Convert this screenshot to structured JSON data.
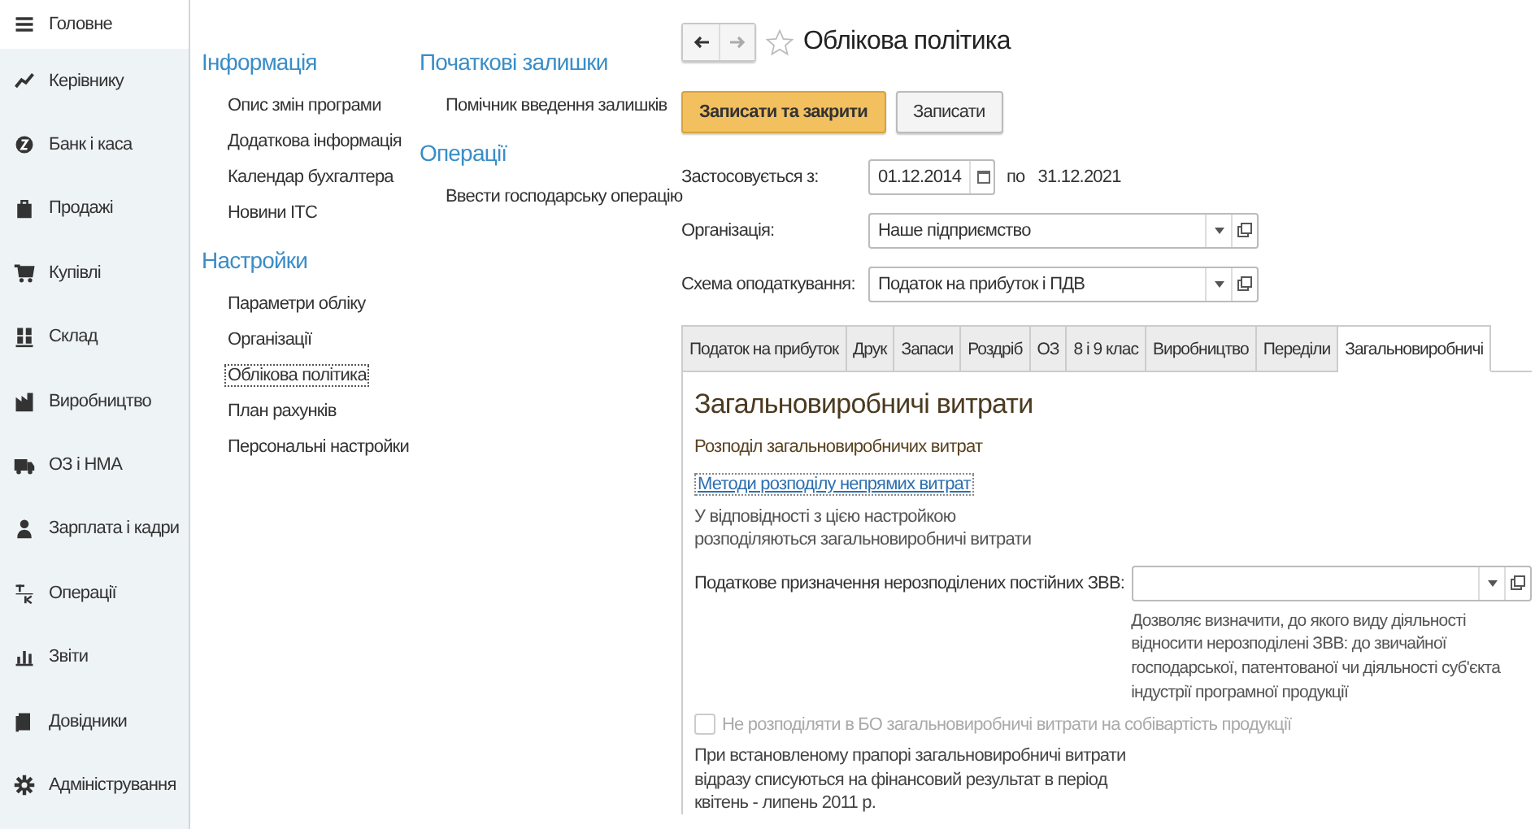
{
  "sidebar": {
    "items": [
      {
        "label": "Головне",
        "selected": true
      },
      {
        "label": "Керівнику",
        "selected": false
      },
      {
        "label": "Банк і каса",
        "selected": false
      },
      {
        "label": "Продажі",
        "selected": false
      },
      {
        "label": "Купівлі",
        "selected": false
      },
      {
        "label": "Склад",
        "selected": false
      },
      {
        "label": "Виробництво",
        "selected": false
      },
      {
        "label": "ОЗ і НМА",
        "selected": false
      },
      {
        "label": "Зарплата і кадри",
        "selected": false
      },
      {
        "label": "Операції",
        "selected": false
      },
      {
        "label": "Звіти",
        "selected": false
      },
      {
        "label": "Довідники",
        "selected": false
      },
      {
        "label": "Адміністрування",
        "selected": false
      }
    ]
  },
  "panel": {
    "columns": [
      [
        {
          "title": "Інформація",
          "items": [
            {
              "label": "Опис змін програми",
              "selected": false
            },
            {
              "label": "Додаткова інформація",
              "selected": false
            },
            {
              "label": "Календар бухгалтера",
              "selected": false
            },
            {
              "label": "Новини ІТС",
              "selected": false
            }
          ]
        },
        {
          "title": "Настройки",
          "items": [
            {
              "label": "Параметри обліку",
              "selected": false
            },
            {
              "label": "Організації",
              "selected": false
            },
            {
              "label": "Облікова політика",
              "selected": true
            },
            {
              "label": "План рахунків",
              "selected": false
            },
            {
              "label": "Персональні настройки",
              "selected": false
            }
          ]
        }
      ],
      [
        {
          "title": "Початкові залишки",
          "items": [
            {
              "label": "Помічник введення залишків",
              "selected": false
            }
          ]
        },
        {
          "title": "Операції",
          "items": [
            {
              "label": "Ввести господарську операцію",
              "selected": false
            }
          ]
        }
      ]
    ]
  },
  "form": {
    "title": "Облікова політика",
    "buttons": [
      {
        "label": "Записати та закрити",
        "kind": "primary"
      },
      {
        "label": "Записати",
        "kind": "default"
      }
    ],
    "fields": [
      {
        "kind": "date",
        "label": "Застосовується з:",
        "value": "01.12.2014",
        "to_label": "по",
        "to_value": "31.12.2021"
      },
      {
        "kind": "select",
        "label": "Організація:",
        "value": "Наше підприємство"
      },
      {
        "kind": "select",
        "label": "Схема оподаткування:",
        "value": "Податок на прибуток і ПДВ"
      }
    ],
    "tabs": [
      {
        "label": "Податок на прибуток",
        "selected": false
      },
      {
        "label": "Друк",
        "selected": false
      },
      {
        "label": "Запаси",
        "selected": false
      },
      {
        "label": "Роздріб",
        "selected": false
      },
      {
        "label": "ОЗ",
        "selected": false
      },
      {
        "label": "8 і 9 клас",
        "selected": false
      },
      {
        "label": "Виробництво",
        "selected": false
      },
      {
        "label": "Переділи",
        "selected": false
      },
      {
        "label": "Загальновиробничі",
        "selected": true
      }
    ],
    "tab_content": {
      "heading": "Загальновиробничі витрати",
      "subheading": "Розподіл загальновиробничих витрат",
      "link": "Методи розподілу непрямих витрат",
      "note": "У відповідності з цією настройкою розподіляються загальновиробничі витрати",
      "field": {
        "label": "Податкове призначення нерозподілених постійних ЗВВ:",
        "hint": "Дозволяє визначити, до якого виду діяльності відносити нерозподілені ЗВВ: до звичайної господарської, патентованої чи діяльності суб'єкта індустрії програмної продукції"
      },
      "checkbox": {
        "label": "Не розподіляти в БО загальновиробничі витрати на собівартість продукції",
        "checked": false,
        "disabled": true
      },
      "footer_note": "При встановленому прапорі загальновиробничі витрати відразу списуються на фінансовий результат в період квітень - липень 2011 р."
    }
  }
}
